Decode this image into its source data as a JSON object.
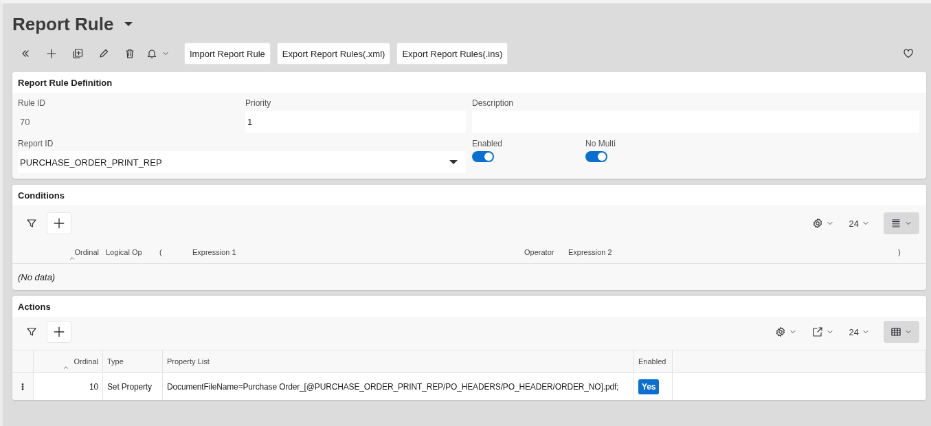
{
  "page": {
    "title": "Report Rule"
  },
  "toolbar": {
    "buttons": [
      "Import Report Rule",
      "Export Report Rules(.xml)",
      "Export Report Rules(.ins)"
    ]
  },
  "definition": {
    "title": "Report Rule Definition",
    "fields": [
      {
        "label": "Rule ID",
        "value": "70",
        "kind": "readonly"
      },
      {
        "label": "Priority",
        "value": "1",
        "kind": "input"
      },
      {
        "label": "Description",
        "kind": "input"
      }
    ],
    "report_id": {
      "label": "Report ID",
      "value": "PURCHASE_ORDER_PRINT_REP"
    },
    "toggles": [
      {
        "label": "Enabled",
        "on": true
      },
      {
        "label": "No Multi",
        "on": true
      }
    ]
  },
  "conditions": {
    "title": "Conditions",
    "page_size": "24",
    "columns": [
      {
        "label": "Ordinal",
        "sorted": true
      },
      {
        "label": "Logical Op",
        "sorted": false
      },
      {
        "label": "(",
        "sorted": false
      },
      {
        "label": "Expression 1",
        "sorted": false
      },
      {
        "label": "Operator",
        "sorted": false
      },
      {
        "label": "Expression 2",
        "sorted": false
      },
      {
        "label": ")",
        "sorted": false
      }
    ],
    "empty_text": "(No data)"
  },
  "actions": {
    "title": "Actions",
    "page_size": "24",
    "columns": [
      {
        "label": "Ordinal",
        "sorted": true
      },
      {
        "label": "Type",
        "sorted": false
      },
      {
        "label": "Property List",
        "sorted": false
      },
      {
        "label": "Enabled",
        "sorted": false
      }
    ],
    "rows": [
      {
        "ordinal": "10",
        "type": "Set Property",
        "property_list": "DocumentFileName=Purchase Order_[@PURCHASE_ORDER_PRINT_REP/PO_HEADERS/PO_HEADER/ORDER_NO].pdf;",
        "enabled": "Yes"
      }
    ]
  }
}
